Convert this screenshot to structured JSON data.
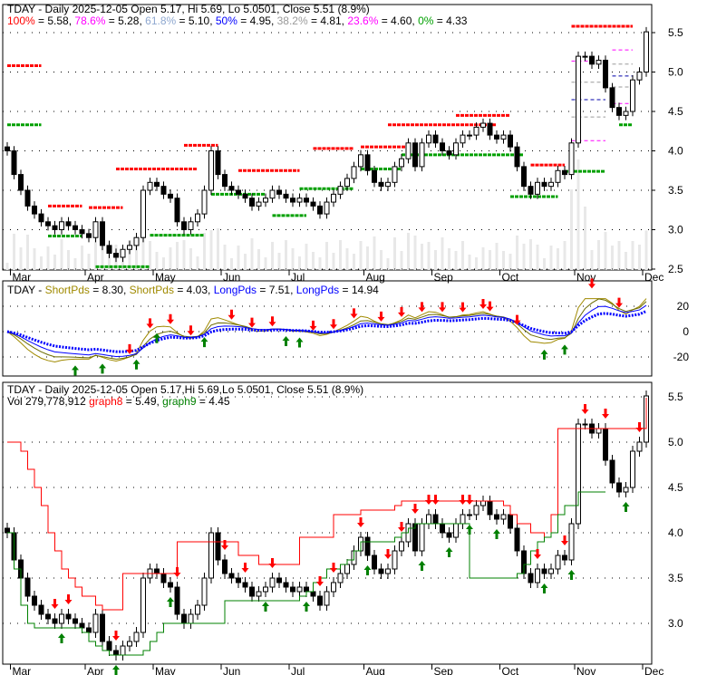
{
  "header": {
    "title": "TDAY - Daily 2025-12-05 Open 5.17, Hi 5.69, Lo 5.0501, Close 5.51 (8.9%)",
    "title3": "TDAY - Daily 2025-12-05 Open 5.17,Hi 5.69,Lo 5.0501, Close 5.51 (8.9%)",
    "fib": [
      {
        "label": "100%",
        "value": " = 5.58, ",
        "color": "#ff0000"
      },
      {
        "label": "78.6%",
        "value": " = 5.28, ",
        "color": "#ff00ff"
      },
      {
        "label": "61.8%",
        "value": " = 5.10, ",
        "color": "#8fa8d0"
      },
      {
        "label": "50%",
        "value": " = 4.95, ",
        "color": "#0000ff"
      },
      {
        "label": "38.2%",
        "value": " = 4.81, ",
        "color": "#9a9a9a"
      },
      {
        "label": "23.6%",
        "value": " = 4.60, ",
        "color": "#ff00ff"
      },
      {
        "label": "0%",
        "value": " = 4.33",
        "color": "#00a000"
      }
    ],
    "osc_prefix": "TDAY - ",
    "osc": [
      {
        "label": "ShortPds",
        "value": " = 8.30, ",
        "color": "#a08a00"
      },
      {
        "label": "ShortPds",
        "value": " = 4.03, ",
        "color": "#a08a00"
      },
      {
        "label": "LongPds",
        "value": " = 7.51, ",
        "color": "#0000ff"
      },
      {
        "label": "LongPds",
        "value": " = 14.94",
        "color": "#0000ff"
      }
    ],
    "vol": "Vol 279,778,912 ",
    "g8": {
      "label": "graph8",
      "value": " = 5.49, ",
      "color": "#ff0000"
    },
    "g9": {
      "label": "graph9",
      "value": " = 4.45",
      "color": "#008000"
    }
  },
  "chart_data": {
    "type": "candlestick",
    "months": [
      "Mar",
      "Apr",
      "May",
      "Jun",
      "Jul",
      "Aug",
      "Sep",
      "Oct",
      "Nov",
      "Dec"
    ],
    "month_index": [
      1,
      12,
      22,
      32,
      42,
      53,
      63,
      73,
      84,
      94
    ],
    "price_ticks": [
      2.5,
      3.0,
      3.5,
      4.0,
      4.5,
      5.0,
      5.5
    ],
    "price_ticks3": [
      3.0,
      3.5,
      4.0,
      4.5,
      5.0,
      5.5
    ],
    "osc_ticks": [
      -20,
      0,
      20
    ],
    "closes": [
      4.0,
      3.7,
      3.5,
      3.3,
      3.2,
      3.1,
      3.05,
      3.0,
      3.1,
      3.05,
      3.0,
      2.95,
      2.9,
      3.1,
      2.8,
      2.7,
      2.65,
      2.75,
      2.8,
      2.9,
      3.5,
      3.6,
      3.55,
      3.45,
      3.4,
      3.1,
      3.0,
      3.1,
      3.2,
      3.5,
      4.0,
      3.7,
      3.55,
      3.5,
      3.45,
      3.4,
      3.3,
      3.35,
      3.4,
      3.5,
      3.45,
      3.4,
      3.35,
      3.4,
      3.35,
      3.3,
      3.2,
      3.35,
      3.45,
      3.55,
      3.65,
      3.8,
      3.95,
      3.75,
      3.6,
      3.55,
      3.6,
      3.8,
      3.9,
      4.1,
      3.8,
      4.1,
      4.2,
      4.1,
      4.0,
      3.95,
      4.1,
      4.2,
      4.2,
      4.3,
      4.35,
      4.2,
      4.15,
      4.2,
      4.05,
      3.8,
      3.55,
      3.45,
      3.6,
      3.55,
      3.6,
      3.75,
      3.7,
      4.1,
      5.2,
      5.2,
      5.1,
      5.15,
      4.8,
      4.55,
      4.45,
      4.5,
      4.9,
      5.0,
      5.51
    ],
    "levels": [
      {
        "from": 0,
        "to": 5,
        "price": 5.08,
        "color": "#ff0000",
        "w": 3
      },
      {
        "from": 0,
        "to": 5,
        "price": 4.33,
        "color": "#00a000",
        "w": 3
      },
      {
        "from": 6,
        "to": 11,
        "price": 3.3,
        "color": "#ff0000",
        "w": 3
      },
      {
        "from": 6,
        "to": 11,
        "price": 2.92,
        "color": "#00a000",
        "w": 3
      },
      {
        "from": 12,
        "to": 17,
        "price": 3.28,
        "color": "#ff0000",
        "w": 3
      },
      {
        "from": 13,
        "to": 21,
        "price": 2.53,
        "color": "#00a000",
        "w": 3
      },
      {
        "from": 16,
        "to": 28,
        "price": 3.77,
        "color": "#ff0000",
        "w": 3
      },
      {
        "from": 21,
        "to": 29,
        "price": 2.93,
        "color": "#00a000",
        "w": 3
      },
      {
        "from": 26,
        "to": 31,
        "price": 4.07,
        "color": "#ff0000",
        "w": 3
      },
      {
        "from": 30,
        "to": 38,
        "price": 3.45,
        "color": "#00a000",
        "w": 3
      },
      {
        "from": 34,
        "to": 43,
        "price": 3.75,
        "color": "#ff0000",
        "w": 3
      },
      {
        "from": 39,
        "to": 44,
        "price": 3.18,
        "color": "#00a000",
        "w": 3
      },
      {
        "from": 45,
        "to": 51,
        "price": 4.03,
        "color": "#ff0000",
        "w": 3
      },
      {
        "from": 43,
        "to": 51,
        "price": 3.52,
        "color": "#00a000",
        "w": 3
      },
      {
        "from": 52,
        "to": 59,
        "price": 4.05,
        "color": "#ff0000",
        "w": 3
      },
      {
        "from": 52,
        "to": 58,
        "price": 3.77,
        "color": "#00a000",
        "w": 3
      },
      {
        "from": 56,
        "to": 72,
        "price": 4.33,
        "color": "#ff0000",
        "w": 3
      },
      {
        "from": 58,
        "to": 76,
        "price": 3.95,
        "color": "#00a000",
        "w": 3
      },
      {
        "from": 66,
        "to": 74,
        "price": 4.45,
        "color": "#ff0000",
        "w": 3
      },
      {
        "from": 74,
        "to": 81,
        "price": 3.42,
        "color": "#00a000",
        "w": 3
      },
      {
        "from": 77,
        "to": 82,
        "price": 3.82,
        "color": "#ff0000",
        "w": 3
      },
      {
        "from": 82,
        "to": 88,
        "price": 3.74,
        "color": "#00a000",
        "w": 3
      },
      {
        "from": 83,
        "to": 92,
        "price": 5.58,
        "color": "#ff0000",
        "w": 3
      },
      {
        "from": 90,
        "to": 92,
        "price": 4.33,
        "color": "#00a000",
        "w": 3
      },
      {
        "from": 83,
        "to": 88,
        "price": 5.14,
        "color": "#ff00ff",
        "w": 1
      },
      {
        "from": 83,
        "to": 88,
        "price": 4.87,
        "color": "#9a9a9a",
        "w": 1
      },
      {
        "from": 83,
        "to": 88,
        "price": 4.65,
        "color": "#0000aa",
        "w": 1
      },
      {
        "from": 83,
        "to": 88,
        "price": 4.43,
        "color": "#9a9a9a",
        "w": 1
      },
      {
        "from": 83,
        "to": 88,
        "price": 4.13,
        "color": "#ff00ff",
        "w": 1
      },
      {
        "from": 89,
        "to": 92,
        "price": 5.28,
        "color": "#ff00ff",
        "w": 1
      },
      {
        "from": 89,
        "to": 92,
        "price": 5.1,
        "color": "#9a9a9a",
        "w": 1
      },
      {
        "from": 89,
        "to": 92,
        "price": 4.95,
        "color": "#0000aa",
        "w": 1
      },
      {
        "from": 89,
        "to": 92,
        "price": 4.81,
        "color": "#9a9a9a",
        "w": 1
      },
      {
        "from": 89,
        "to": 92,
        "price": 4.6,
        "color": "#ff00ff",
        "w": 1
      }
    ],
    "graph8": [
      5.0,
      5.0,
      4.9,
      4.7,
      4.5,
      4.3,
      4.0,
      3.8,
      3.6,
      3.5,
      3.4,
      3.3,
      3.3,
      3.2,
      3.15,
      3.15,
      3.15,
      3.55,
      3.55,
      3.55,
      3.55,
      3.55,
      3.55,
      3.55,
      3.55,
      3.9,
      3.9,
      3.9,
      3.9,
      3.9,
      3.9,
      3.9,
      3.9,
      3.9,
      3.75,
      3.75,
      3.75,
      3.65,
      3.65,
      3.65,
      3.65,
      3.65,
      3.65,
      3.95,
      3.95,
      3.95,
      3.95,
      3.95,
      4.2,
      4.2,
      4.2,
      4.2,
      4.25,
      4.25,
      4.25,
      4.25,
      4.25,
      4.3,
      4.35,
      4.35,
      4.35,
      4.35,
      4.35,
      4.35,
      4.35,
      4.35,
      4.35,
      4.35,
      4.35,
      4.35,
      4.35,
      4.35,
      4.35,
      4.3,
      4.2,
      4.1,
      4.1,
      4.0,
      4.0,
      3.95,
      4.2,
      5.15,
      5.15,
      5.15,
      5.15,
      5.15,
      5.15,
      5.15,
      5.15,
      5.15,
      5.15,
      5.15,
      5.15,
      5.15,
      5.49
    ],
    "graph9": [
      4.0,
      3.6,
      3.2,
      3.0,
      2.95,
      2.95,
      2.95,
      2.95,
      2.95,
      2.95,
      2.95,
      2.9,
      2.8,
      2.75,
      2.7,
      2.65,
      2.65,
      2.65,
      2.65,
      2.65,
      2.7,
      2.8,
      2.9,
      3.0,
      3.0,
      3.0,
      3.0,
      3.0,
      3.0,
      3.0,
      3.0,
      3.0,
      3.25,
      3.25,
      3.25,
      3.25,
      3.25,
      3.25,
      3.25,
      3.25,
      3.25,
      3.25,
      3.25,
      3.3,
      3.35,
      3.45,
      3.5,
      3.6,
      3.6,
      3.65,
      3.7,
      3.8,
      3.9,
      3.9,
      3.9,
      3.9,
      3.9,
      3.95,
      4.0,
      4.05,
      4.1,
      4.1,
      4.1,
      4.1,
      4.1,
      4.1,
      4.1,
      4.1,
      3.5,
      3.5,
      3.5,
      3.5,
      3.5,
      3.5,
      3.5,
      3.55,
      3.65,
      3.8,
      3.9,
      3.95,
      4.0,
      4.2,
      4.3,
      4.3,
      4.45,
      4.45,
      4.45,
      4.45,
      4.45
    ],
    "up_arrows": [
      10,
      14,
      19,
      22,
      29,
      41,
      43,
      79,
      82
    ],
    "down_arrows": [
      18,
      21,
      24,
      27,
      33,
      36,
      39,
      45,
      48,
      51,
      55,
      58,
      61,
      64,
      67,
      70,
      71,
      75,
      86,
      90
    ],
    "up_arrows3": [
      8,
      16,
      24,
      38,
      44,
      53,
      61,
      65,
      68,
      72,
      79,
      83,
      91
    ],
    "down_arrows3": [
      7,
      9,
      16,
      25,
      32,
      35,
      39,
      46,
      48,
      52,
      56,
      58,
      60,
      62,
      63,
      67,
      68,
      78,
      82,
      85,
      88,
      93
    ]
  }
}
